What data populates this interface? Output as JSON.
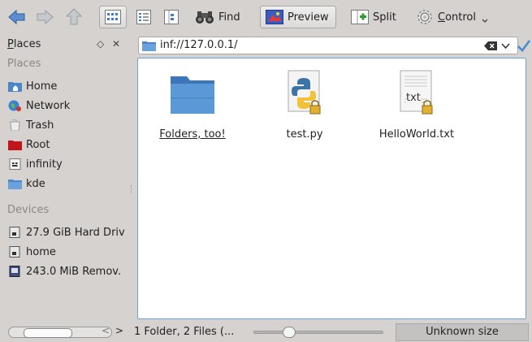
{
  "toolbar": {
    "find_label": "Find",
    "preview_label": "Preview",
    "split_label": "Split",
    "control_label": "Control"
  },
  "places": {
    "title": "Places",
    "section_places": "Places",
    "items": [
      {
        "label": "Home",
        "icon": "home-folder-icon"
      },
      {
        "label": "Network",
        "icon": "network-globe-icon"
      },
      {
        "label": "Trash",
        "icon": "trash-icon"
      },
      {
        "label": "Root",
        "icon": "root-folder-icon"
      },
      {
        "label": "infinity",
        "icon": "host-icon"
      },
      {
        "label": "kde",
        "icon": "folder-icon"
      }
    ],
    "section_devices": "Devices",
    "devices": [
      {
        "label": "27.9 GiB Hard Driv",
        "icon": "hard-drive-icon"
      },
      {
        "label": "home",
        "icon": "hard-drive-icon"
      },
      {
        "label": "243.0 MiB Remov.",
        "icon": "removable-drive-icon"
      }
    ]
  },
  "location": {
    "url": "inf://127.0.0.1/"
  },
  "files": [
    {
      "name": "Folders, too!",
      "type": "folder"
    },
    {
      "name": "test.py",
      "type": "python"
    },
    {
      "name": "HelloWorld.txt",
      "type": "text",
      "badge": "txt"
    }
  ],
  "status": {
    "summary": "1 Folder, 2 Files (...",
    "size": "Unknown size",
    "zoom_fraction": 0.25
  },
  "colors": {
    "accent": "#6ba3d6",
    "folder_blue": "#4a86c8",
    "root_red": "#c0151b"
  }
}
